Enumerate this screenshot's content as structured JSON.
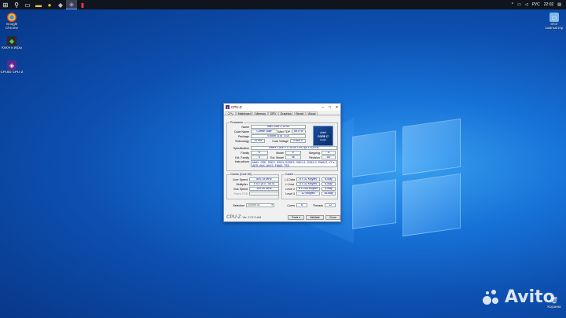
{
  "taskbar": {
    "tray_lang": "РУС",
    "tray_time": "22:02"
  },
  "desktop": {
    "icons": [
      {
        "label": "Google Chrome"
      },
      {
        "label": "Ключ и игры"
      },
      {
        "label": "CPUID CPU-Z"
      }
    ],
    "this_pc": "Этот компьютер",
    "recycle": "Корзина"
  },
  "watermark": "Avito",
  "cpuz": {
    "title": "CPU-Z",
    "tabs": [
      "CPU",
      "Mainboard",
      "Memory",
      "SPD",
      "Graphics",
      "Bench",
      "About"
    ],
    "processor_group": "Processor",
    "name_label": "Name",
    "name_value": "Intel Core i7 8700",
    "codename_label": "Code Name",
    "codename_value": "Coffee Lake",
    "maxtdp_label": "Max TDP",
    "maxtdp_value": "65.0 W",
    "package_label": "Package",
    "package_value": "Socket 1151 LGA",
    "technology_label": "Technology",
    "technology_value": "14 nm",
    "corevoltage_label": "Core Voltage",
    "corevoltage_value": "0.664 V",
    "spec_label": "Specification",
    "spec_value": "Intel® Core™ i7-8700 CPU @ 3.20GHz",
    "family_label": "Family",
    "family_value": "6",
    "model_label": "Model",
    "model_value": "E",
    "stepping_label": "Stepping",
    "stepping_value": "A",
    "extfamily_label": "Ext. Family",
    "extfamily_value": "6",
    "extmodel_label": "Ext. Model",
    "extmodel_value": "9E",
    "revision_label": "Revision",
    "revision_value": "U0",
    "instr_label": "Instructions",
    "instr_value1": "MMX, SSE, SSE2, SSE3, SSSE3, SSE4.1, SSE4.2, EM64T, VT-x,",
    "instr_value2": "AES, AVX, AVX2, FMA3, TSX",
    "intel_logo": {
      "brand": "intel",
      "line1": "CORE i7",
      "line2": "inside"
    },
    "clocks_group": "Clocks (Core #0)",
    "corespeed_label": "Core Speed",
    "corespeed_value": "800.19 MHz",
    "multiplier_label": "Multiplier",
    "multiplier_value": "x 8.0 (8.0 - 46.0)",
    "busspeed_label": "Bus Speed",
    "busspeed_value": "100.00 MHz",
    "ratedfsb_label": "Rated FSB",
    "cache_group": "Cache",
    "l1d_label": "L1 Data",
    "l1d_value": "6 x 32 KBytes",
    "l1d_way": "8-way",
    "l1i_label": "L1 Inst.",
    "l1i_value": "6 x 32 KBytes",
    "l1i_way": "8-way",
    "l2_label": "Level 2",
    "l2_value": "6 x 256 KBytes",
    "l2_way": "4-way",
    "l3_label": "Level 3",
    "l3_value": "12 MBytes",
    "l3_way": "16-way",
    "selection_label": "Selection",
    "selection_value": "Socket #1",
    "cores_label": "Cores",
    "cores_value": "6",
    "threads_label": "Threads",
    "threads_value": "12",
    "logo": "CPU-Z",
    "version": "Ver. 2.07.0.x64",
    "tools_button": "Tools",
    "validate_button": "Validate",
    "close_button": "Close"
  }
}
